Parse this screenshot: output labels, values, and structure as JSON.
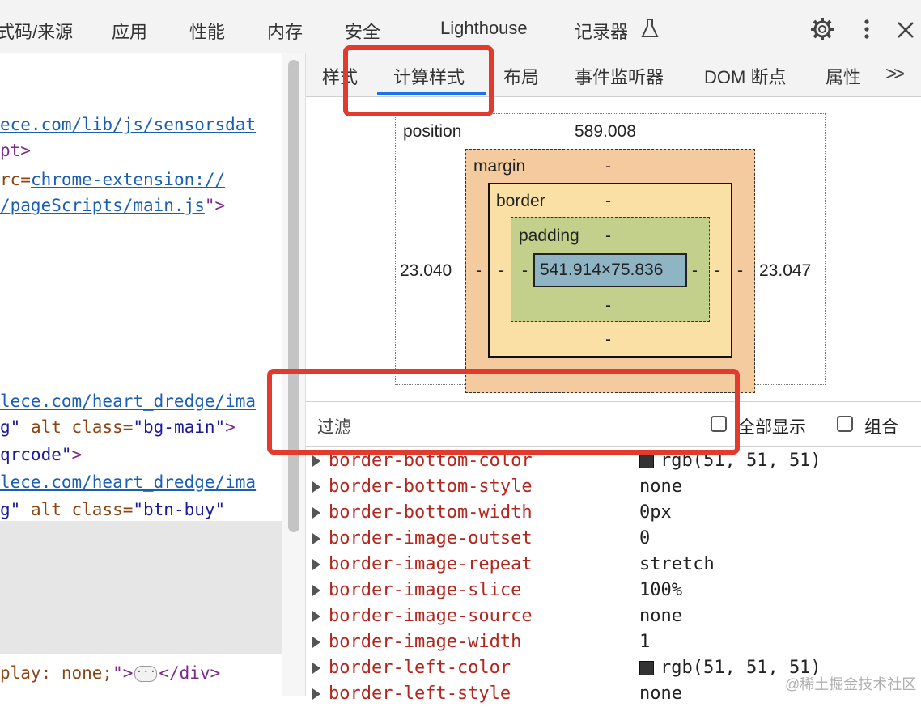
{
  "top_tabs": [
    "式码/来源",
    "应用",
    "性能",
    "内存",
    "安全",
    "Lighthouse",
    "记录器"
  ],
  "top_icons": {
    "flask": "flask-icon",
    "settings": "gear-icon",
    "menu": "kebab-menu-icon",
    "close": "close-icon"
  },
  "left_code": {
    "l1": "ece.com/lib/js/sensorsdat",
    "l2_tag": "pt>",
    "l3_attr": "rc=",
    "l3_link": "chrome-extension://",
    "l4_link": "/pageScripts/main.js",
    "l4_tail": "\">",
    "l5_link": "lece.com/heart_dredge/ima",
    "l6_val": "g\"",
    "l6_attr": " alt class=",
    "l6_cls": "\"bg-main\"",
    "l6_tail": ">",
    "l7_val": "qrcode\"",
    "l7_tail": ">",
    "l8_link": "lece.com/heart_dredge/ima",
    "l9_val": "g\"",
    "l9_attr": " alt class=",
    "l9_cls": "\"btn-buy\"",
    "l10_attr": "play: none;",
    "l10_tail": "\">",
    "l10_end": "</div>"
  },
  "sub_tabs": [
    "样式",
    "计算样式",
    "布局",
    "事件监听器",
    "DOM 断点",
    "属性"
  ],
  "sub_tab_more": ">>",
  "box_model": {
    "position_label": "position",
    "position_value": "589.008",
    "margin_label": "margin",
    "margin_value": "-",
    "border_label": "border",
    "border_value": "-",
    "padding_label": "padding",
    "padding_value": "-",
    "left_value": "23.040",
    "right_value": "23.047",
    "content_size": "541.914×75.836",
    "dash": "-"
  },
  "filter": {
    "placeholder": "过滤",
    "show_all_label": "全部显示",
    "group_label": "组合"
  },
  "properties": [
    {
      "name": "border-bottom-color",
      "value": "rgb(51, 51, 51)",
      "swatch": "#333333"
    },
    {
      "name": "border-bottom-style",
      "value": "none"
    },
    {
      "name": "border-bottom-width",
      "value": "0px"
    },
    {
      "name": "border-image-outset",
      "value": "0"
    },
    {
      "name": "border-image-repeat",
      "value": "stretch"
    },
    {
      "name": "border-image-slice",
      "value": "100%"
    },
    {
      "name": "border-image-source",
      "value": "none"
    },
    {
      "name": "border-image-width",
      "value": "1"
    },
    {
      "name": "border-left-color",
      "value": "rgb(51, 51, 51)",
      "swatch": "#333333"
    },
    {
      "name": "border-left-style",
      "value": "none"
    }
  ],
  "watermark": "@稀土掘金技术社区",
  "colors": {
    "highlight_red": "#e23b2e",
    "margin_fill": "#f4cb9e",
    "border_fill": "#fbe0a6",
    "padding_fill": "#c3d08b",
    "content_fill": "#8fb4c4"
  }
}
